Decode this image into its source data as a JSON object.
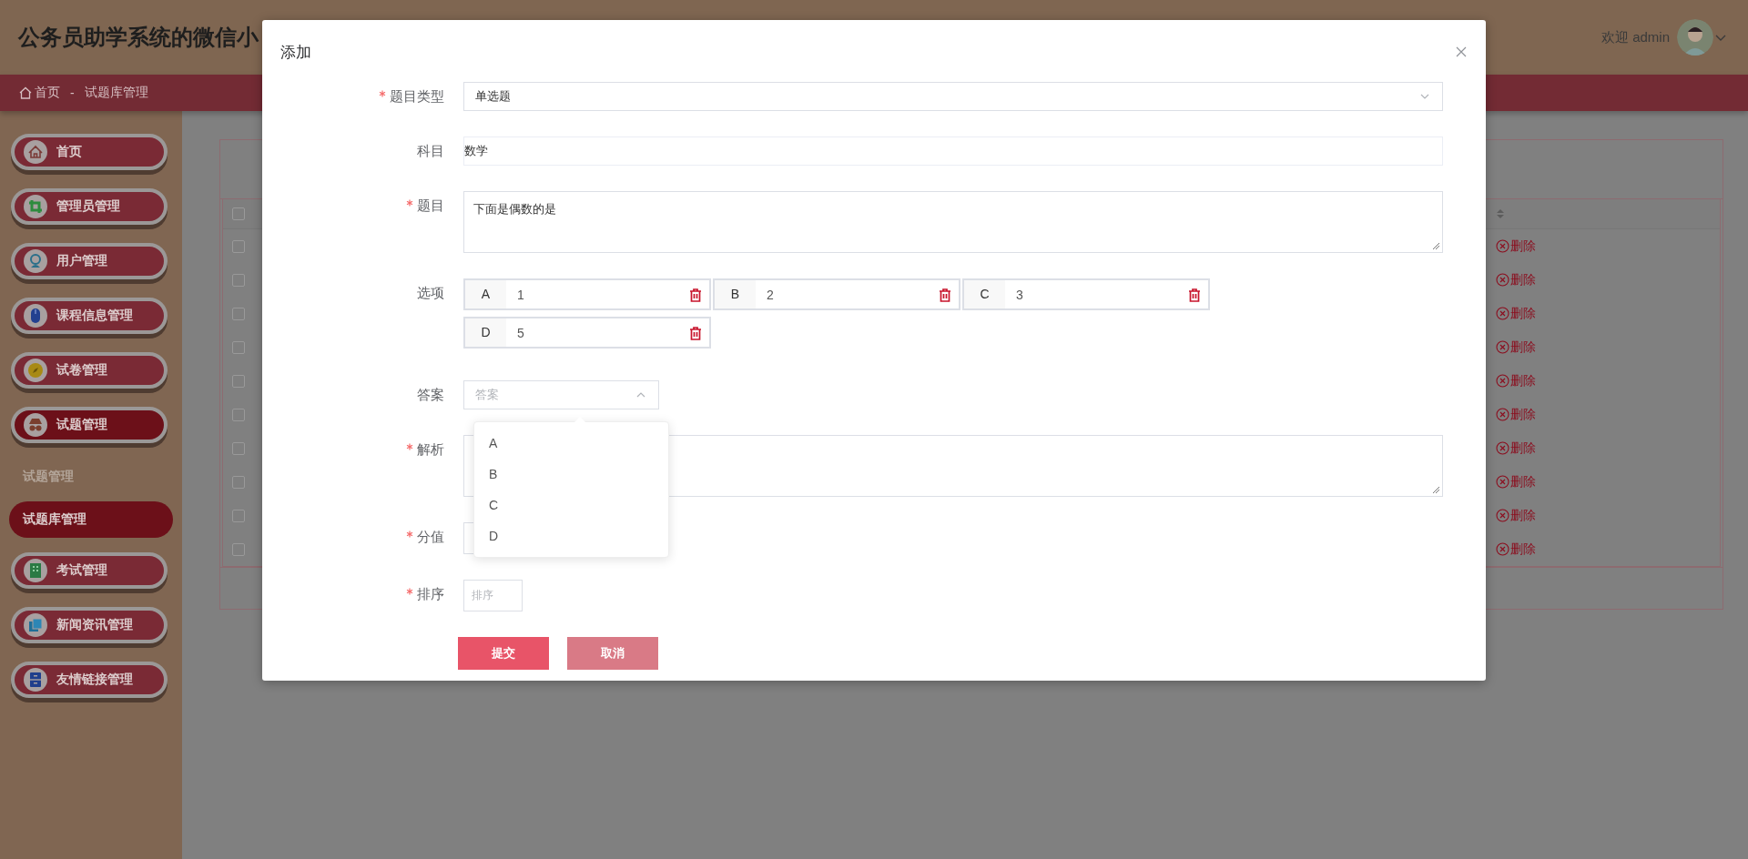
{
  "header": {
    "title": "公务员助学系统的微信小",
    "welcome": "欢迎 admin"
  },
  "breadcrumb": {
    "home": "首页",
    "separator": "-",
    "current": "试题库管理"
  },
  "sidebar": {
    "items": [
      {
        "label": "首页",
        "selected": false
      },
      {
        "label": "管理员管理",
        "selected": false
      },
      {
        "label": "用户管理",
        "selected": false
      },
      {
        "label": "课程信息管理",
        "selected": false
      },
      {
        "label": "试卷管理",
        "selected": false
      },
      {
        "label": "试题管理",
        "selected": true,
        "children": [
          {
            "label": "试题管理",
            "kind": "group",
            "selected": false
          },
          {
            "label": "试题库管理",
            "kind": "item",
            "selected": true
          }
        ]
      },
      {
        "label": "考试管理",
        "selected": false
      },
      {
        "label": "新闻资讯管理",
        "selected": false
      },
      {
        "label": "友情链接管理",
        "selected": false
      }
    ]
  },
  "table": {
    "header": {
      "checked": false
    },
    "rows": [
      {
        "checked": false,
        "action": "删除"
      },
      {
        "checked": false,
        "action": "删除"
      },
      {
        "checked": false,
        "action": "删除"
      },
      {
        "checked": false,
        "action": "删除"
      },
      {
        "checked": false,
        "action": "删除"
      },
      {
        "checked": false,
        "action": "删除"
      },
      {
        "checked": false,
        "action": "删除"
      },
      {
        "checked": false,
        "action": "删除"
      },
      {
        "checked": false,
        "action": "删除"
      },
      {
        "checked": false,
        "action": "删除"
      }
    ]
  },
  "dialog": {
    "title": "添加",
    "fields": [
      {
        "label": "题目类型",
        "required": true,
        "kind": "select",
        "value": "单选题",
        "open": false
      },
      {
        "label": "科目",
        "required": false,
        "kind": "readonly",
        "value": "数学"
      },
      {
        "label": "题目",
        "required": true,
        "kind": "textarea",
        "value": "下面是偶数的是"
      },
      {
        "label": "选项",
        "required": false,
        "kind": "options",
        "options": [
          {
            "key": "A",
            "value": "1"
          },
          {
            "key": "B",
            "value": "2"
          },
          {
            "key": "C",
            "value": "3"
          },
          {
            "key": "D",
            "value": "5"
          }
        ]
      },
      {
        "label": "答案",
        "required": false,
        "kind": "select",
        "placeholder": "答案",
        "open": true,
        "choices": [
          "A",
          "B",
          "C",
          "D"
        ]
      },
      {
        "label": "解析",
        "required": true,
        "kind": "textarea"
      },
      {
        "label": "分值",
        "required": true,
        "kind": "input"
      },
      {
        "label": "排序",
        "required": true,
        "kind": "input",
        "placeholder": "排序"
      }
    ],
    "buttons": [
      {
        "label": "提交",
        "kind": "primary"
      },
      {
        "label": "取消",
        "kind": "secondary"
      }
    ]
  }
}
